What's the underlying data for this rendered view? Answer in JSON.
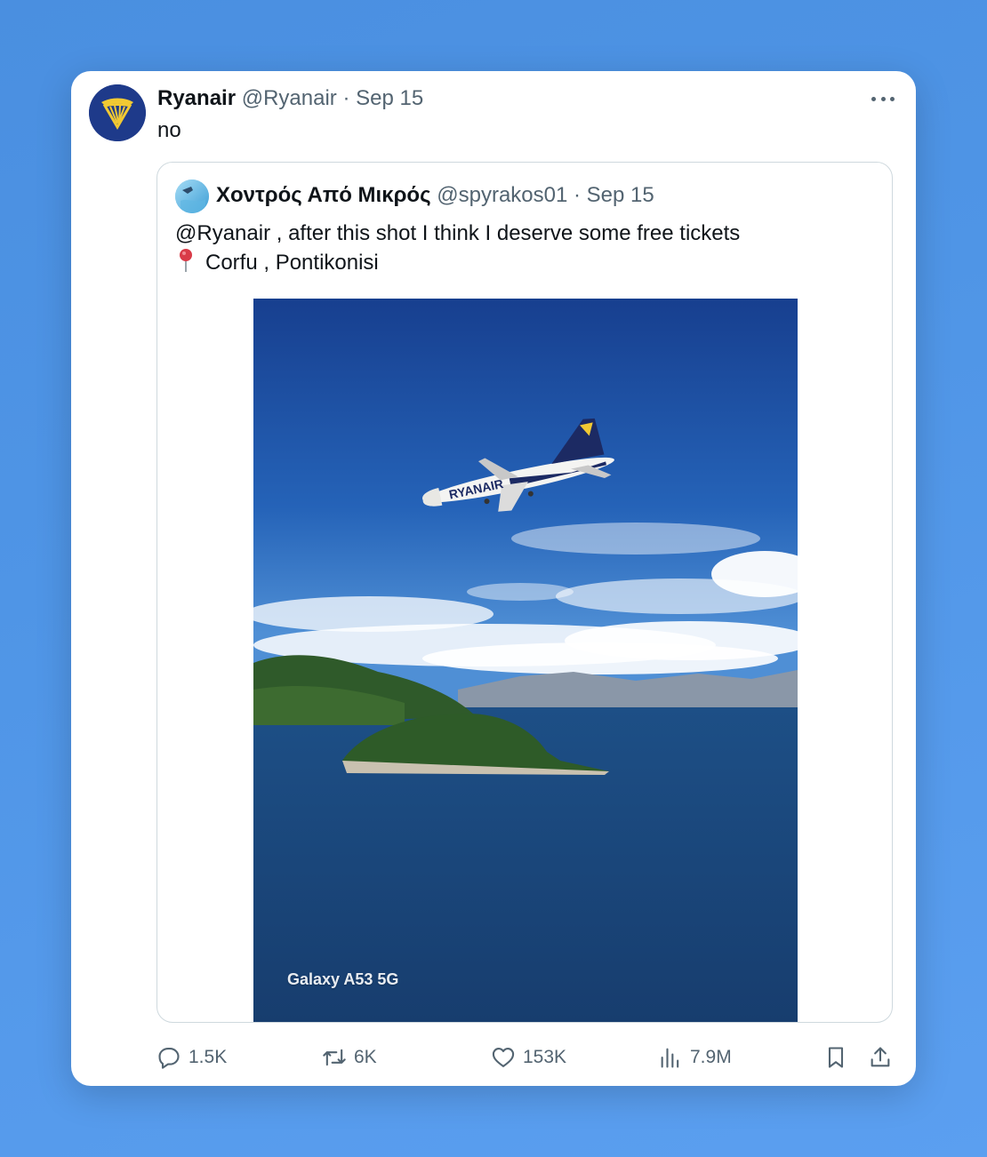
{
  "tweet": {
    "author_name": "Ryanair",
    "author_handle": "@Ryanair",
    "separator": "·",
    "date": "Sep 15",
    "text": "no"
  },
  "quote": {
    "author_name": "Χοντρός Από Μικρός",
    "author_handle": "@spyrakos01",
    "separator": "·",
    "date": "Sep 15",
    "text_line1": "@Ryanair , after this shot I think I deserve some free tickets",
    "text_line2": "Corfu , Pontikonisi",
    "photo_watermark": "Galaxy A53 5G"
  },
  "actions": {
    "replies": "1.5K",
    "reposts": "6K",
    "likes": "153K",
    "views": "7.9M"
  },
  "icons": {
    "more": "more-icon",
    "reply": "reply-icon",
    "repost": "repost-icon",
    "like": "heart-icon",
    "views": "views-icon",
    "bookmark": "bookmark-icon",
    "share": "share-icon",
    "pin": "round-pushpin-icon"
  },
  "colors": {
    "brand_navy": "#1e3a8a",
    "brand_yellow": "#f1c933",
    "muted_text": "#536471"
  }
}
